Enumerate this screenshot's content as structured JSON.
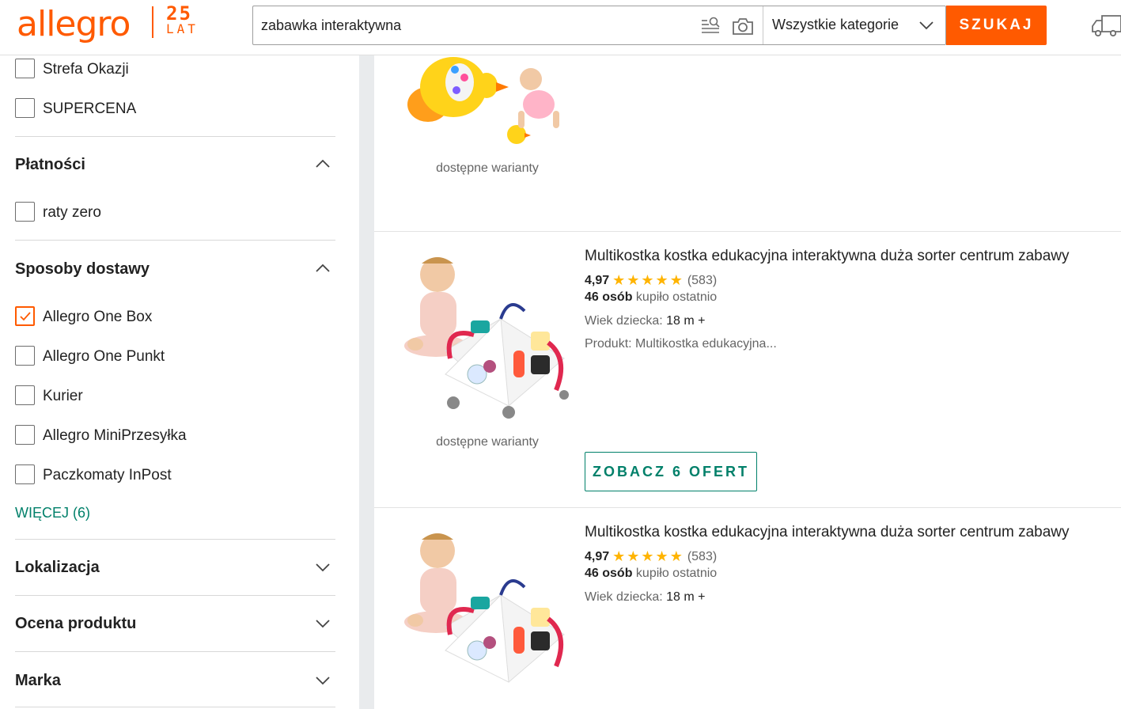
{
  "header": {
    "logo": "allegro",
    "badge_number": "25",
    "badge_text": "LAT",
    "search_value": "zabawka interaktywna",
    "category_selected": "Wszystkie kategorie",
    "search_button": "SZUKAJ",
    "accent_color": "#ff5a00"
  },
  "sidebar": {
    "top_checks": [
      {
        "label": "Strefa Okazji",
        "checked": false
      },
      {
        "label": "SUPERCENA",
        "checked": false
      }
    ],
    "payments": {
      "title": "Płatności",
      "options": [
        {
          "label": "raty zero",
          "checked": false
        }
      ]
    },
    "delivery": {
      "title": "Sposoby dostawy",
      "options": [
        {
          "label": "Allegro One Box",
          "checked": true
        },
        {
          "label": "Allegro One Punkt",
          "checked": false
        },
        {
          "label": "Kurier",
          "checked": false
        },
        {
          "label": "Allegro MiniPrzesyłka",
          "checked": false
        },
        {
          "label": "Paczkomaty InPost",
          "checked": false
        }
      ],
      "more": "WIĘCEJ (6)"
    },
    "collapsed_sections": [
      "Lokalizacja",
      "Ocena produktu",
      "Marka"
    ]
  },
  "listings": [
    {
      "variants": "dostępne warianty"
    },
    {
      "title": "Multikostka kostka edukacyjna interaktywna duża sorter centrum zabawy",
      "rating": "4,97",
      "stars": "★★★★★",
      "reviews": "(583)",
      "buyers_bold": "46 osób",
      "buyers_rest": " kupiło ostatnio",
      "param1_label": "Wiek dziecka: ",
      "param1_value": "18 m +",
      "param2_label": "Produkt: ",
      "param2_value": "Multikostka edukacyjna...",
      "variants": "dostępne warianty",
      "button": "ZOBACZ 6 OFERT"
    },
    {
      "title": "Multikostka kostka edukacyjna interaktywna duża sorter centrum zabawy",
      "rating": "4,97",
      "stars": "★★★★★",
      "reviews": "(583)",
      "buyers_bold": "46 osób",
      "buyers_rest": " kupiło ostatnio",
      "param1_label": "Wiek dziecka: ",
      "param1_value": "18 m +"
    }
  ]
}
